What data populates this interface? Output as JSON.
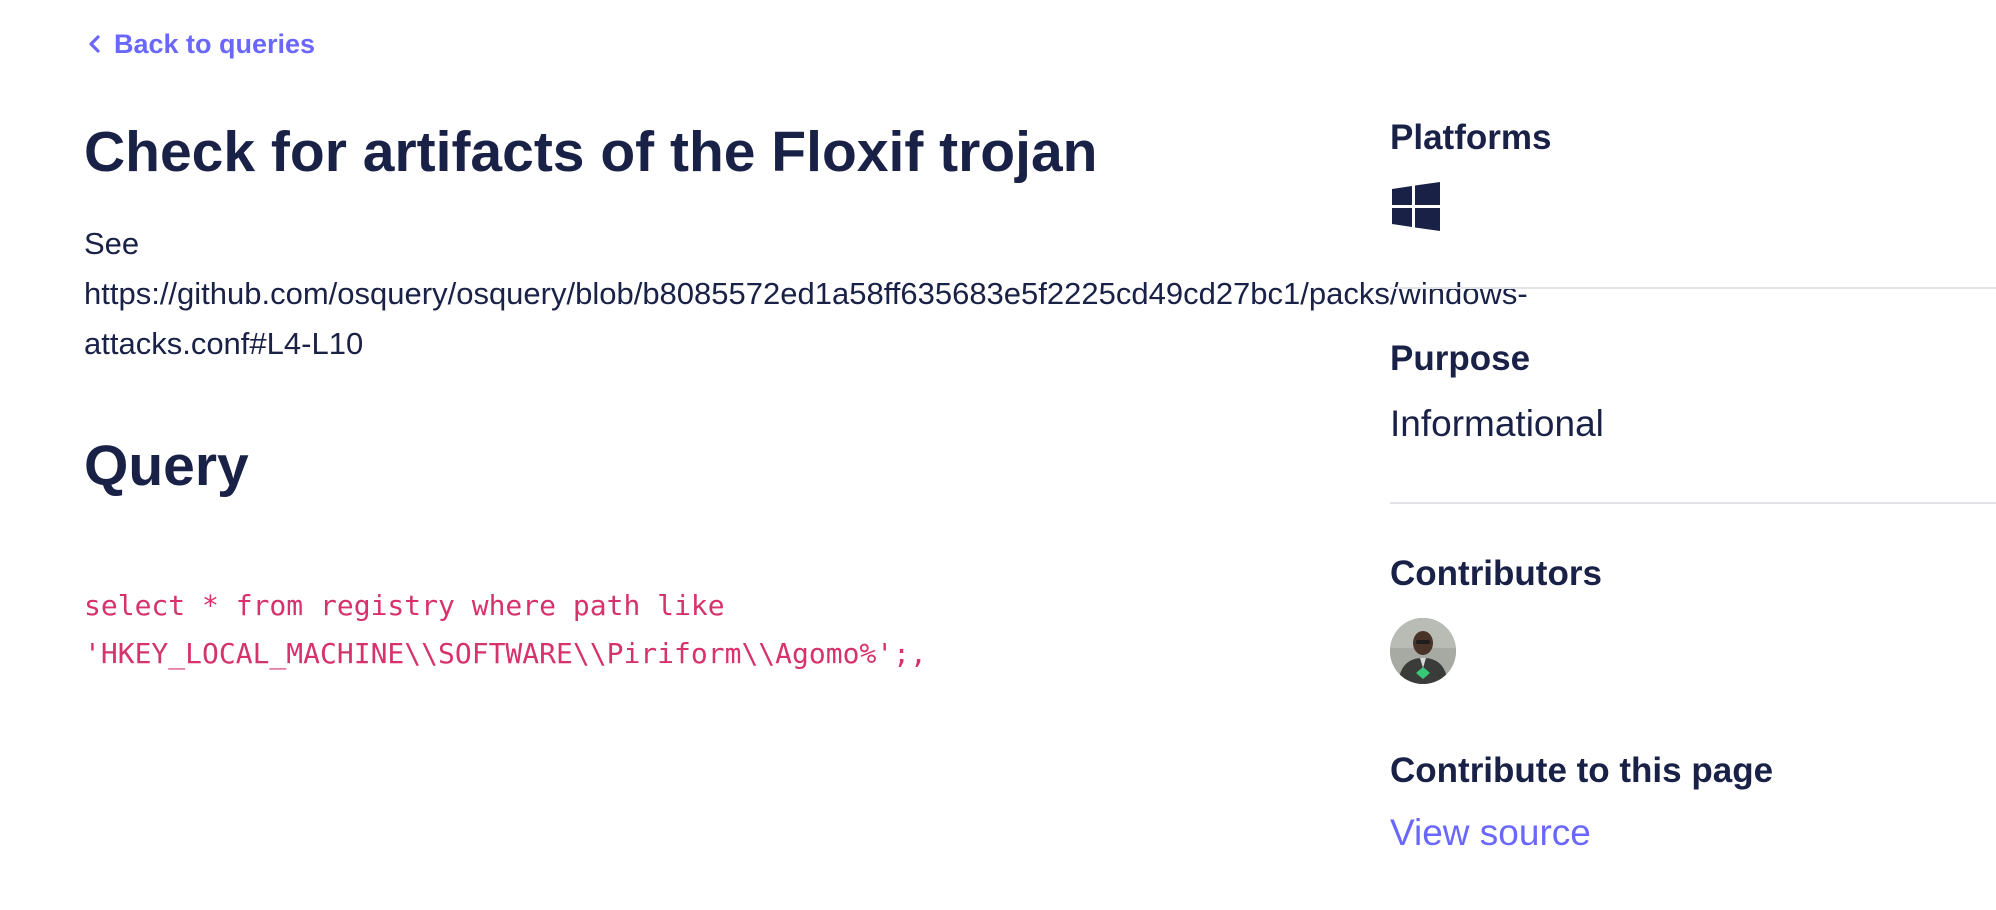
{
  "nav": {
    "back_label": "Back to queries"
  },
  "main": {
    "title": "Check for artifacts of the Floxif trojan",
    "description_lines": [
      "See",
      "https://github.com/osquery/osquery/blob/b8085572ed1a58ff635683e5f2225cd49cd27bc1/packs/windows-",
      "attacks.conf#L4-L10"
    ],
    "query_heading": "Query",
    "query_lines": [
      "select * from registry where path like",
      "'HKEY_LOCAL_MACHINE\\\\SOFTWARE\\\\Piriform\\\\Agomo%';,"
    ]
  },
  "sidebar": {
    "platforms_heading": "Platforms",
    "platform_icons": [
      "windows-icon"
    ],
    "purpose_heading": "Purpose",
    "purpose_value": "Informational",
    "contributors_heading": "Contributors",
    "contribute_heading": "Contribute to this page",
    "view_source_label": "View source"
  },
  "colors": {
    "text": "#192147",
    "link": "#6a67fe",
    "code": "#d6336c",
    "divider": "#e2e4ea"
  }
}
